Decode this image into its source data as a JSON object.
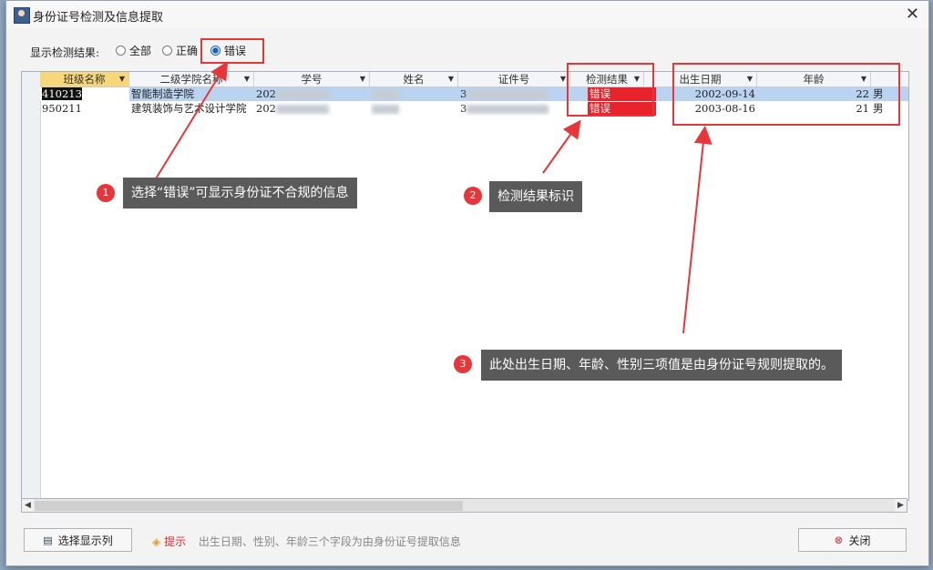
{
  "window": {
    "title": "身份证号检测及信息提取",
    "close_icon": "close-icon"
  },
  "filter": {
    "label": "显示检测结果:",
    "options": [
      {
        "label": "全部",
        "selected": false
      },
      {
        "label": "正确",
        "selected": false
      },
      {
        "label": "错误",
        "selected": true
      }
    ]
  },
  "table": {
    "columns": [
      "班级名称",
      "二级学院名称",
      "学号",
      "姓名",
      "证件号",
      "检测结果",
      "出生日期",
      "年龄"
    ],
    "rows": [
      {
        "class": "410213",
        "college": "智能制造学院",
        "student_id": "202",
        "name": "",
        "id_number": "3",
        "result": "错误",
        "birth": "2002-09-14",
        "age": "22",
        "gender": "男"
      },
      {
        "class": "950211",
        "college": "建筑装饰与艺术设计学院",
        "student_id": "202",
        "name": "",
        "id_number": "3",
        "result": "错误",
        "birth": "2003-08-16",
        "age": "21",
        "gender": "男"
      }
    ]
  },
  "footer": {
    "select_columns": "选择显示列",
    "tip_label": "提示",
    "tip_text": "出生日期、性别、年龄三个字段为由身份证号提取信息",
    "close": "关闭"
  },
  "callouts": [
    {
      "number": "1",
      "text": "选择“错误”可显示身份证不合规的信息"
    },
    {
      "number": "2",
      "text": "检测结果标识"
    },
    {
      "number": "3",
      "text": "此处出生日期、年龄、性别三项值是由身份证号规则提取的。"
    }
  ],
  "colors": {
    "highlight_red": "#e8353a",
    "error_cell": "#e8232b",
    "selected_row": "#b9d3f0",
    "callout_bg": "#5a5a5a"
  }
}
